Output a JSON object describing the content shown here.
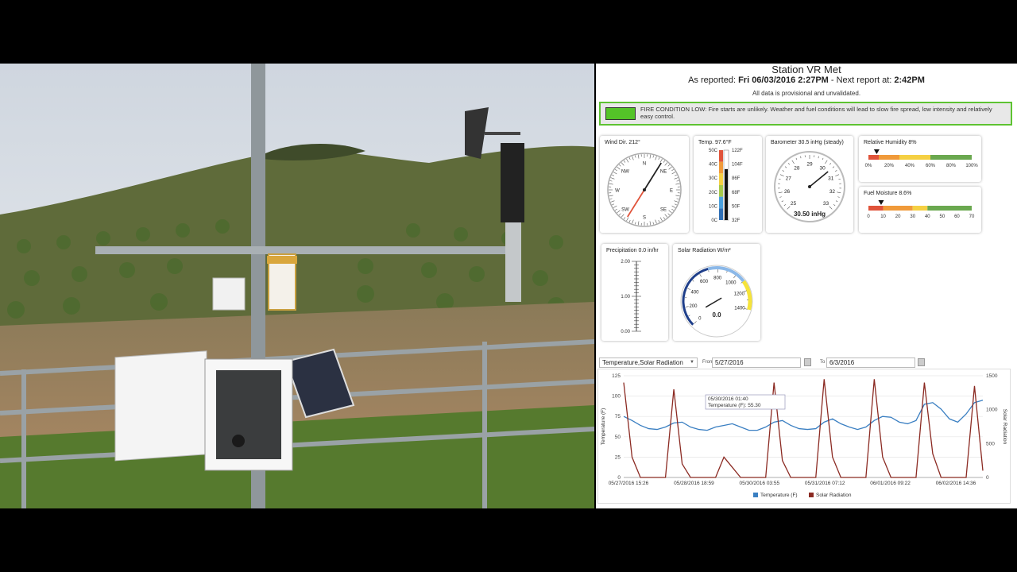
{
  "station": {
    "title": "Station VR Met",
    "reported_prefix": "As reported:",
    "reported_time": "Fri 06/03/2016 2:27PM",
    "next_prefix": "- Next report at:",
    "next_time": "2:42PM",
    "provisional": "All data is provisional and unvalidated."
  },
  "fire": {
    "text": "FIRE CONDITION LOW: Fire starts are unlikely. Weather and fuel conditions will lead to slow fire spread, low intensity and relatively easy control.",
    "color": "#54c428"
  },
  "wind": {
    "label": "Wind Dir. 212°",
    "direction_deg": 212,
    "points": [
      "N",
      "NE",
      "E",
      "SE",
      "S",
      "SW",
      "W",
      "NW"
    ]
  },
  "temperature": {
    "label": "Temp. 97.6°F",
    "value_f": 97.6,
    "c_ticks": [
      "50C",
      "40C",
      "30C",
      "20C",
      "10C",
      "0C"
    ],
    "f_ticks": [
      "122F",
      "104F",
      "86F",
      "68F",
      "50F",
      "32F"
    ]
  },
  "barometer": {
    "label": "Barometer 30.5 inHg (steady)",
    "value": 30.5,
    "readout": "30.50 inHg",
    "ticks": [
      "25",
      "26",
      "27",
      "28",
      "29",
      "30",
      "31",
      "32",
      "33"
    ]
  },
  "humidity": {
    "label": "Relative Humidity 8%",
    "value": 8,
    "ticks": [
      "0%",
      "20%",
      "40%",
      "60%",
      "80%",
      "100%"
    ]
  },
  "fuel": {
    "label": "Fuel Moisture 8.6%",
    "value": 8.6,
    "ticks": [
      "0",
      "10",
      "20",
      "30",
      "40",
      "50",
      "60",
      "70"
    ]
  },
  "precip": {
    "label": "Precipitation 0.0 in/hr",
    "value": 0.0,
    "ticks": [
      "2.00",
      "1.00",
      "0.00"
    ]
  },
  "solar": {
    "label": "Solar Radiation W/m²",
    "value": 0,
    "readout": "0.0",
    "ticks": [
      "0",
      "200",
      "400",
      "600",
      "800",
      "1000",
      "1200",
      "1400"
    ]
  },
  "controls": {
    "series_select": "Temperature,Solar Radiation",
    "from_label": "From",
    "from_date": "5/27/2016",
    "to_label": "To",
    "to_date": "6/3/2016"
  },
  "chart_data": {
    "type": "line",
    "x_labels": [
      "05/27/2016 15:26",
      "05/28/2016 18:59",
      "05/30/2016 03:55",
      "05/31/2016 07:12",
      "06/01/2016 09:22",
      "06/02/2016 14:36"
    ],
    "ylabel_left": "Temperature (F)",
    "ylabel_right": "Solar Radiation",
    "yleft_ticks": [
      "125",
      "100",
      "75",
      "50",
      "25",
      "0"
    ],
    "yright_ticks": [
      "1500",
      "1000",
      "500",
      "0"
    ],
    "ylim_left": [
      0,
      125
    ],
    "ylim_right": [
      0,
      1500
    ],
    "series": [
      {
        "name": "Temperature (F)",
        "color": "#3a7fc2",
        "values": [
          75,
          70,
          64,
          60,
          59,
          62,
          67,
          68,
          62,
          59,
          58,
          62,
          64,
          66,
          62,
          58,
          58,
          62,
          68,
          70,
          64,
          60,
          59,
          60,
          68,
          72,
          66,
          62,
          59,
          62,
          70,
          75,
          74,
          68,
          66,
          70,
          90,
          92,
          84,
          72,
          68,
          78,
          92,
          95
        ]
      },
      {
        "name": "Solar Radiation",
        "color": "#8b2a22",
        "values": [
          1400,
          300,
          0,
          0,
          0,
          0,
          1300,
          200,
          0,
          0,
          0,
          0,
          300,
          150,
          0,
          0,
          0,
          0,
          1400,
          250,
          0,
          0,
          0,
          0,
          1450,
          300,
          0,
          0,
          0,
          0,
          1450,
          300,
          0,
          0,
          0,
          0,
          1400,
          350,
          0,
          0,
          0,
          0,
          1350,
          100
        ]
      }
    ],
    "tooltip": {
      "date": "05/30/2016 01:40",
      "text": "Temperature (F): 55.30"
    }
  }
}
